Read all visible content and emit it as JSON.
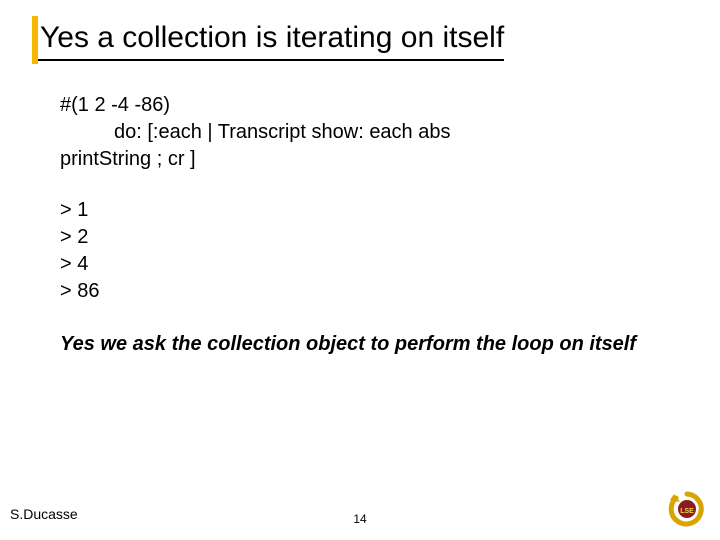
{
  "title": "Yes a collection is iterating on itself",
  "code": {
    "line1": "#(1 2 -4 -86)",
    "line2": "do: [:each | Transcript show: each abs",
    "line3": "printString ; cr ]"
  },
  "output": {
    "rows": [
      "> 1",
      "> 2",
      "> 4",
      "> 86"
    ]
  },
  "emphasis": "Yes we ask the collection object to perform the loop on itself",
  "footer": {
    "author": "S.Ducasse",
    "page": "14"
  },
  "logo": {
    "name": "lse-logo"
  }
}
